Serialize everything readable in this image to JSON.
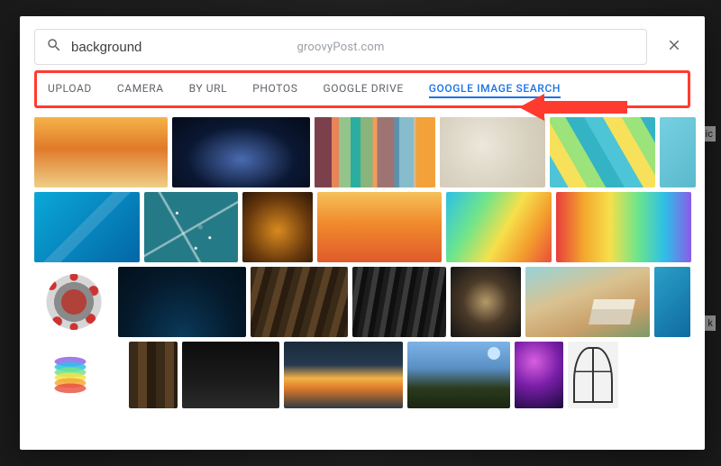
{
  "search": {
    "value": "background"
  },
  "watermark": "groovyPost.com",
  "close_label": "Close",
  "tabs": {
    "upload": "UPLOAD",
    "camera": "CAMERA",
    "by_url": "BY URL",
    "photos": "PHOTOS",
    "google_drive": "GOOGLE DRIVE",
    "google_image_search": "GOOGLE IMAGE SEARCH",
    "active": "google_image_search"
  },
  "bg_snippets": {
    "click1": "Clic",
    "k": "k"
  },
  "annotation": {
    "tabs_highlight": true,
    "arrow_points_to": "tabs"
  },
  "colors": {
    "active_tab": "#1a73e8",
    "annotation": "#ff3b30",
    "text_muted": "#5f6368"
  },
  "results": {
    "row1": [
      {
        "name": "abstract-orange-texture"
      },
      {
        "name": "milky-way-night-sky"
      },
      {
        "name": "colorful-mosaic-squares"
      },
      {
        "name": "beige-paper-texture"
      },
      {
        "name": "teal-yellow-triangles-pattern"
      },
      {
        "name": "teal-gradient-partial"
      }
    ],
    "row2": [
      {
        "name": "blue-diagonal-gradient"
      },
      {
        "name": "teal-swirl-lines"
      },
      {
        "name": "dark-orange-vignette"
      },
      {
        "name": "warm-sunset-gradient"
      },
      {
        "name": "low-poly-rainbow"
      },
      {
        "name": "rainbow-horizontal-stripes"
      }
    ],
    "row3": [
      {
        "name": "coronavirus-render"
      },
      {
        "name": "dark-blue-horizon"
      },
      {
        "name": "diagonal-wood-planks"
      },
      {
        "name": "dark-gray-planks"
      },
      {
        "name": "brown-bokeh-blur"
      },
      {
        "name": "open-book-grass"
      },
      {
        "name": "blue-gradient-partial"
      }
    ],
    "row4": [
      {
        "name": "rainbow-arc-white"
      },
      {
        "name": "vertical-wood-planks"
      },
      {
        "name": "dark-spotlight"
      },
      {
        "name": "sunset-clouds-horizon"
      },
      {
        "name": "moonlit-field"
      },
      {
        "name": "purple-nebula"
      },
      {
        "name": "arched-window-bw"
      }
    ]
  }
}
